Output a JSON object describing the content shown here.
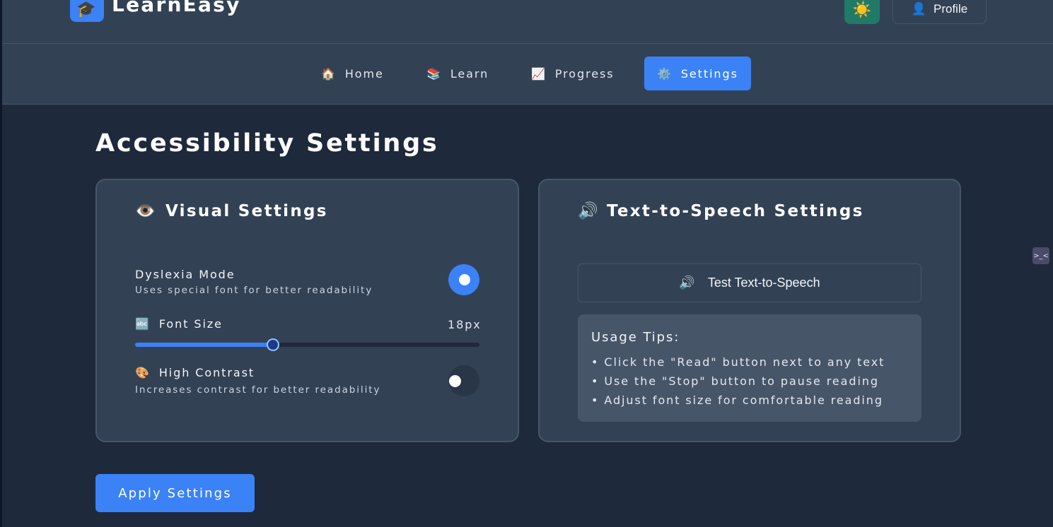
{
  "header": {
    "logo_icon": "🎓",
    "brand": "LearnEasy",
    "theme_icon": "☀️",
    "profile_icon": "👤",
    "profile_label": "Profile"
  },
  "nav": {
    "items": [
      {
        "icon": "🏠",
        "label": "Home"
      },
      {
        "icon": "📚",
        "label": "Learn"
      },
      {
        "icon": "📈",
        "label": "Progress"
      },
      {
        "icon": "⚙️",
        "label": "Settings",
        "active": true
      }
    ]
  },
  "main": {
    "page_title": "Accessibility Settings",
    "visual": {
      "icon": "👁️",
      "title": "Visual Settings",
      "dyslexia_label": "Dyslexia Mode",
      "dyslexia_desc": "Uses special font for better readability",
      "dyslexia_on": true,
      "font_icon": "🔤",
      "font_label": "Font Size",
      "font_value": "18px",
      "font_slider_fraction": 0.4,
      "contrast_icon": "🎨",
      "contrast_label": "High Contrast",
      "contrast_desc": "Increases contrast for better readability",
      "contrast_on": false
    },
    "tts": {
      "icon": "🔊",
      "title": "Text-to-Speech Settings",
      "test_icon": "🔊",
      "test_label": "Test Text-to-Speech",
      "tips_title": "Usage Tips:",
      "tips": [
        "• Click the \"Read\" button next to any text",
        "• Use the \"Stop\" button to pause reading",
        "• Adjust font size for comfortable reading"
      ]
    },
    "apply_label": "Apply Settings"
  },
  "side_widget": ">_<",
  "colors": {
    "accent": "#3b82f6",
    "background": "#1e293b",
    "panel": "#334155",
    "theme_button": "#1f7a68"
  }
}
